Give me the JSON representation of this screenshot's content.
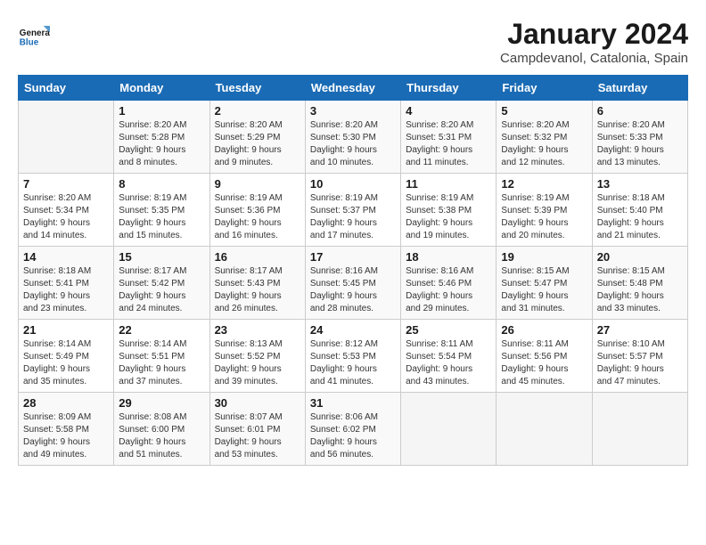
{
  "logo": {
    "line1": "General",
    "line2": "Blue"
  },
  "title": "January 2024",
  "subtitle": "Campdevanol, Catalonia, Spain",
  "days_of_week": [
    "Sunday",
    "Monday",
    "Tuesday",
    "Wednesday",
    "Thursday",
    "Friday",
    "Saturday"
  ],
  "weeks": [
    [
      {
        "day": "",
        "info": ""
      },
      {
        "day": "1",
        "info": "Sunrise: 8:20 AM\nSunset: 5:28 PM\nDaylight: 9 hours\nand 8 minutes."
      },
      {
        "day": "2",
        "info": "Sunrise: 8:20 AM\nSunset: 5:29 PM\nDaylight: 9 hours\nand 9 minutes."
      },
      {
        "day": "3",
        "info": "Sunrise: 8:20 AM\nSunset: 5:30 PM\nDaylight: 9 hours\nand 10 minutes."
      },
      {
        "day": "4",
        "info": "Sunrise: 8:20 AM\nSunset: 5:31 PM\nDaylight: 9 hours\nand 11 minutes."
      },
      {
        "day": "5",
        "info": "Sunrise: 8:20 AM\nSunset: 5:32 PM\nDaylight: 9 hours\nand 12 minutes."
      },
      {
        "day": "6",
        "info": "Sunrise: 8:20 AM\nSunset: 5:33 PM\nDaylight: 9 hours\nand 13 minutes."
      }
    ],
    [
      {
        "day": "7",
        "info": "Sunrise: 8:20 AM\nSunset: 5:34 PM\nDaylight: 9 hours\nand 14 minutes."
      },
      {
        "day": "8",
        "info": "Sunrise: 8:19 AM\nSunset: 5:35 PM\nDaylight: 9 hours\nand 15 minutes."
      },
      {
        "day": "9",
        "info": "Sunrise: 8:19 AM\nSunset: 5:36 PM\nDaylight: 9 hours\nand 16 minutes."
      },
      {
        "day": "10",
        "info": "Sunrise: 8:19 AM\nSunset: 5:37 PM\nDaylight: 9 hours\nand 17 minutes."
      },
      {
        "day": "11",
        "info": "Sunrise: 8:19 AM\nSunset: 5:38 PM\nDaylight: 9 hours\nand 19 minutes."
      },
      {
        "day": "12",
        "info": "Sunrise: 8:19 AM\nSunset: 5:39 PM\nDaylight: 9 hours\nand 20 minutes."
      },
      {
        "day": "13",
        "info": "Sunrise: 8:18 AM\nSunset: 5:40 PM\nDaylight: 9 hours\nand 21 minutes."
      }
    ],
    [
      {
        "day": "14",
        "info": "Sunrise: 8:18 AM\nSunset: 5:41 PM\nDaylight: 9 hours\nand 23 minutes."
      },
      {
        "day": "15",
        "info": "Sunrise: 8:17 AM\nSunset: 5:42 PM\nDaylight: 9 hours\nand 24 minutes."
      },
      {
        "day": "16",
        "info": "Sunrise: 8:17 AM\nSunset: 5:43 PM\nDaylight: 9 hours\nand 26 minutes."
      },
      {
        "day": "17",
        "info": "Sunrise: 8:16 AM\nSunset: 5:45 PM\nDaylight: 9 hours\nand 28 minutes."
      },
      {
        "day": "18",
        "info": "Sunrise: 8:16 AM\nSunset: 5:46 PM\nDaylight: 9 hours\nand 29 minutes."
      },
      {
        "day": "19",
        "info": "Sunrise: 8:15 AM\nSunset: 5:47 PM\nDaylight: 9 hours\nand 31 minutes."
      },
      {
        "day": "20",
        "info": "Sunrise: 8:15 AM\nSunset: 5:48 PM\nDaylight: 9 hours\nand 33 minutes."
      }
    ],
    [
      {
        "day": "21",
        "info": "Sunrise: 8:14 AM\nSunset: 5:49 PM\nDaylight: 9 hours\nand 35 minutes."
      },
      {
        "day": "22",
        "info": "Sunrise: 8:14 AM\nSunset: 5:51 PM\nDaylight: 9 hours\nand 37 minutes."
      },
      {
        "day": "23",
        "info": "Sunrise: 8:13 AM\nSunset: 5:52 PM\nDaylight: 9 hours\nand 39 minutes."
      },
      {
        "day": "24",
        "info": "Sunrise: 8:12 AM\nSunset: 5:53 PM\nDaylight: 9 hours\nand 41 minutes."
      },
      {
        "day": "25",
        "info": "Sunrise: 8:11 AM\nSunset: 5:54 PM\nDaylight: 9 hours\nand 43 minutes."
      },
      {
        "day": "26",
        "info": "Sunrise: 8:11 AM\nSunset: 5:56 PM\nDaylight: 9 hours\nand 45 minutes."
      },
      {
        "day": "27",
        "info": "Sunrise: 8:10 AM\nSunset: 5:57 PM\nDaylight: 9 hours\nand 47 minutes."
      }
    ],
    [
      {
        "day": "28",
        "info": "Sunrise: 8:09 AM\nSunset: 5:58 PM\nDaylight: 9 hours\nand 49 minutes."
      },
      {
        "day": "29",
        "info": "Sunrise: 8:08 AM\nSunset: 6:00 PM\nDaylight: 9 hours\nand 51 minutes."
      },
      {
        "day": "30",
        "info": "Sunrise: 8:07 AM\nSunset: 6:01 PM\nDaylight: 9 hours\nand 53 minutes."
      },
      {
        "day": "31",
        "info": "Sunrise: 8:06 AM\nSunset: 6:02 PM\nDaylight: 9 hours\nand 56 minutes."
      },
      {
        "day": "",
        "info": ""
      },
      {
        "day": "",
        "info": ""
      },
      {
        "day": "",
        "info": ""
      }
    ]
  ]
}
